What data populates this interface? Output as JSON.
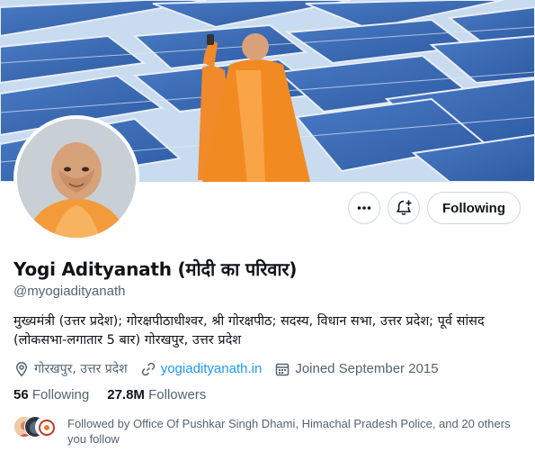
{
  "profile": {
    "name": "Yogi Adityanath (मोदी का परिवार)",
    "handle": "@myogiadityanath",
    "bio_line1": "मुख्यमंत्री (उत्तर प्रदेश); गोरक्षपीठाधीश्वर, श्री गोरक्षपीठ; सदस्य, विधान सभा, उत्तर प्रदेश; पूर्व सांसद",
    "bio_line2": "(लोकसभा-लगातार 5 बार) गोरखपुर, उत्तर प्रदेश",
    "location": "गोरखपुर, उत्तर प्रदेश",
    "website": "yogiadityanath.in",
    "joined": "Joined September 2015",
    "following_count": "56",
    "following_label": "Following",
    "followers_count": "27.8M",
    "followers_label": "Followers",
    "followed_by": "Followed by Office Of Pushkar Singh Dhami, Himachal Pradesh Police, and 20 others you follow"
  },
  "actions": {
    "follow_state_label": "Following",
    "more_icon": "more-horizontal-icon",
    "notify_icon": "bell-plus-icon"
  },
  "colors": {
    "accent": "#1d9bf0",
    "secondary_text": "#536471",
    "border": "#cfd9de"
  }
}
